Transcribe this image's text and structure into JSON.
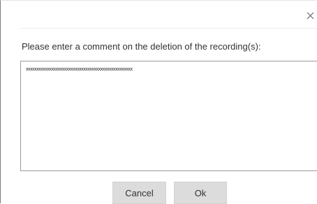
{
  "dialog": {
    "close_icon": "close-icon",
    "prompt": "Please enter a comment on the deletion of the recording(s):",
    "comment_value": "xxxxxxxxxxxxxxxxxxxxxxxxxxxxxxxxxxxxxxxxxxxxxxxxxx",
    "cancel_label": "Cancel",
    "ok_label": "Ok"
  },
  "colors": {
    "button_bg": "#dcdcdc",
    "border": "#9a9a9a",
    "text": "#333333"
  }
}
